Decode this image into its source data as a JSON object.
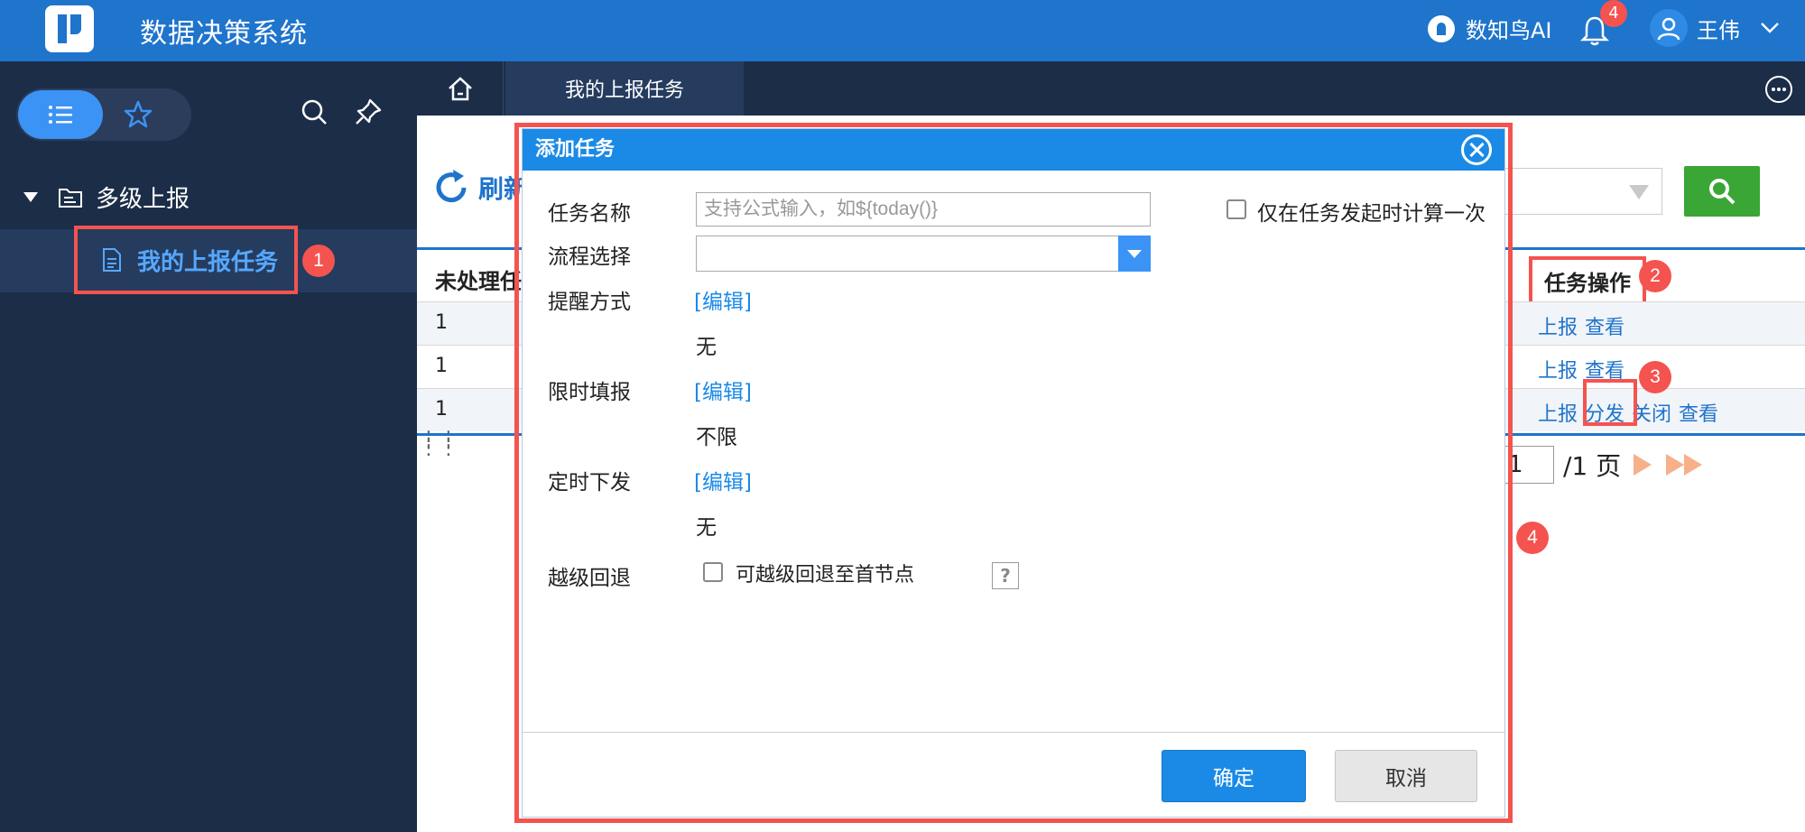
{
  "header": {
    "app_title": "数据决策系统",
    "ai_label": "数知鸟AI",
    "notification_count": "4",
    "user_name": "王伟"
  },
  "sidebar": {
    "folder_label": "多级上报",
    "item_label": "我的上报任务"
  },
  "tabs": {
    "active": "我的上报任务"
  },
  "toolbar": {
    "refresh_label": "刷新"
  },
  "table": {
    "col_left": "未处理任",
    "col_ops": "任务操作",
    "rows": [
      {
        "num": "1",
        "ops": [
          "上报",
          "查看"
        ]
      },
      {
        "num": "1",
        "ops": [
          "上报",
          "查看"
        ]
      },
      {
        "num": "1",
        "ops": [
          "上报",
          "分发",
          "关闭",
          "查看"
        ]
      }
    ]
  },
  "pager": {
    "current": "1",
    "total_label": "/1 页"
  },
  "annotations": [
    "1",
    "2",
    "3",
    "4"
  ],
  "dialog": {
    "title": "添加任务",
    "task_name_label": "任务名称",
    "task_name_placeholder": "支持公式输入，如${today()}",
    "calc_once_label": "仅在任务发起时计算一次",
    "flow_label": "流程选择",
    "remind_label": "提醒方式",
    "edit_link": "[编辑]",
    "remind_value": "无",
    "time_limit_label": "限时填报",
    "time_limit_value": "不限",
    "schedule_label": "定时下发",
    "schedule_value": "无",
    "rollback_label": "越级回退",
    "rollback_option": "可越级回退至首节点",
    "help": "?",
    "ok": "确定",
    "cancel": "取消"
  },
  "colors": {
    "brand_blue": "#1f74cc",
    "sidebar_bg": "#1c2d48",
    "annotation_red": "#f4534f",
    "search_green": "#3aa635"
  }
}
